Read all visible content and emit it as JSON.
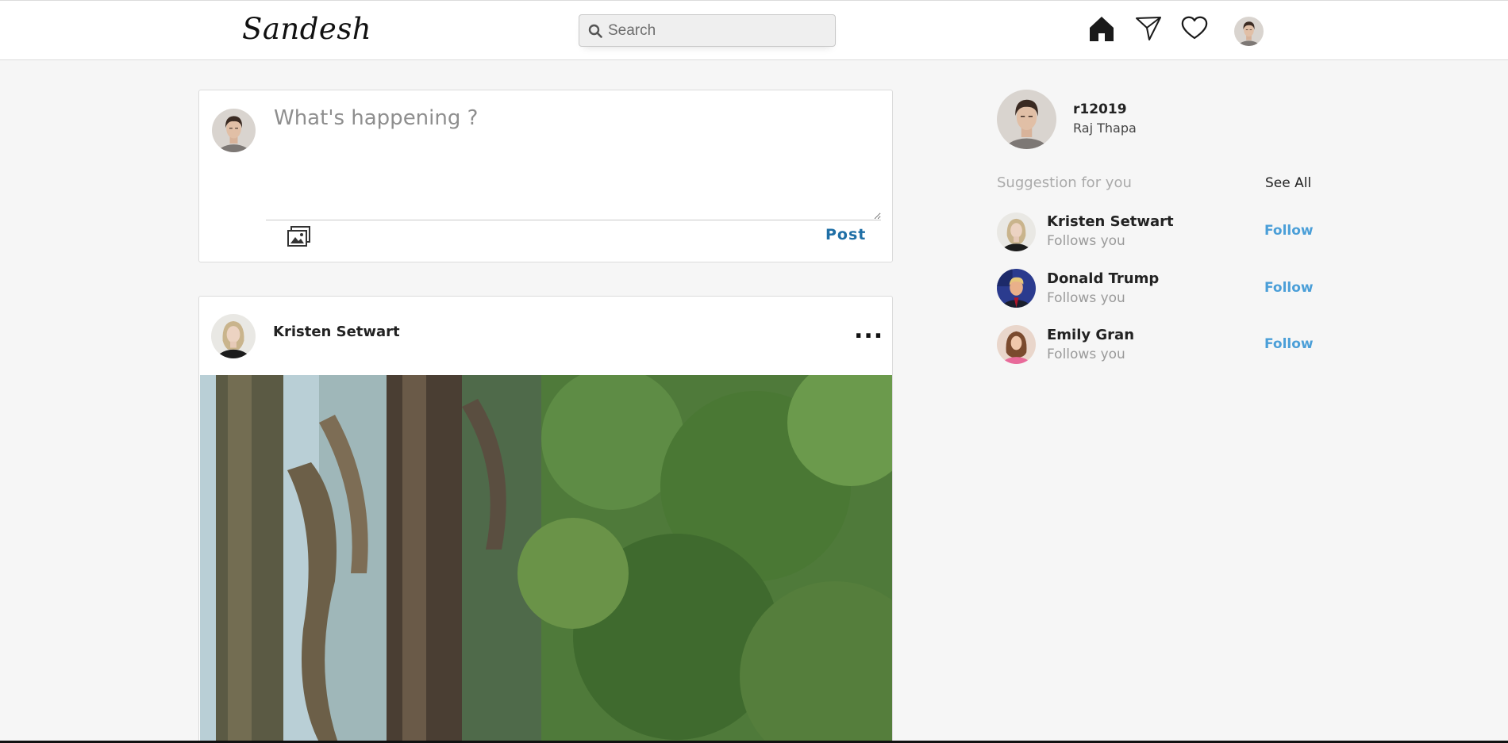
{
  "app": {
    "logo": "Sandesh"
  },
  "header": {
    "search_placeholder": "Search",
    "icons": [
      "home-icon",
      "send-icon",
      "heart-icon",
      "profile-avatar"
    ]
  },
  "composer": {
    "placeholder": "What's happening ?",
    "post_label": "Post",
    "icons": [
      "image-upload-icon"
    ]
  },
  "feed": [
    {
      "author": "Kristen Setwart",
      "more_label": "...",
      "image": "forest photo"
    }
  ],
  "sidebar": {
    "username": "r12019",
    "full_name": "Raj Thapa",
    "suggestion_title": "Suggestion for you",
    "see_all_label": "See All",
    "suggestions": [
      {
        "name": "Kristen Setwart",
        "subtitle": "Follows you",
        "action": "Follow"
      },
      {
        "name": "Donald Trump",
        "subtitle": "Follows you",
        "action": "Follow"
      },
      {
        "name": "Emily Gran",
        "subtitle": "Follows you",
        "action": "Follow"
      }
    ]
  },
  "colors": {
    "accent": "#4b9fd8",
    "post_blue": "#1f6fa6",
    "background": "#f6f6f6"
  }
}
